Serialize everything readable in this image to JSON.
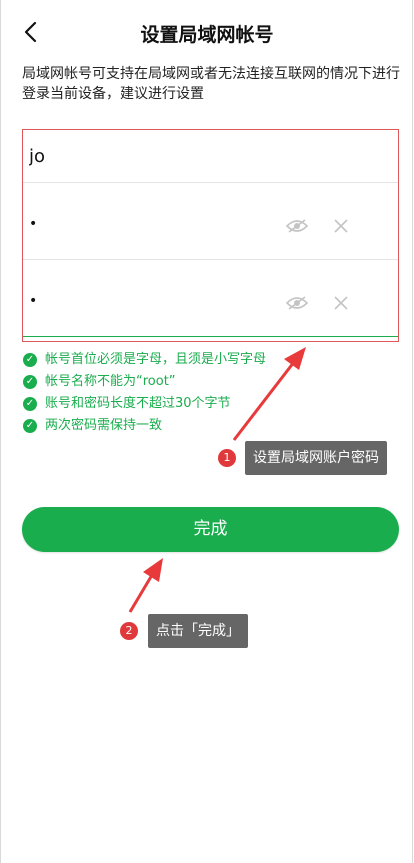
{
  "header": {
    "title": "设置局域网帐号",
    "back_icon": "chevron-left-icon"
  },
  "description": "局域网帐号可支持在局域网或者无法连接互联网的情况下进行登录当前设备，建议进行设置",
  "form": {
    "username_value": "jo",
    "password_value": "•",
    "confirm_password_value": "•",
    "eye_icon": "eye-slash-icon",
    "clear_icon": "close-icon"
  },
  "rules": [
    {
      "text": "帐号首位必须是字母，且须是小写字母"
    },
    {
      "text": "帐号名称不能为“root”"
    },
    {
      "text": "账号和密码长度不超过30个字节"
    },
    {
      "text": "两次密码需保持一致"
    }
  ],
  "done_button": {
    "label": "完成"
  },
  "annotations": [
    {
      "step": "1",
      "text": "设置局域网账户密码"
    },
    {
      "step": "2",
      "text": "点击「完成」"
    }
  ],
  "colors": {
    "accent": "#1aad4e",
    "highlight_border": "#e0585a",
    "arrow": "#e8393b",
    "tooltip_bg": "#666666"
  }
}
